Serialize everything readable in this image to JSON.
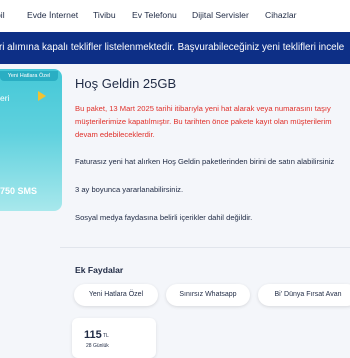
{
  "nav": {
    "items": [
      "bil",
      "Evde İnternet",
      "Tivibu",
      "Ev Telefonu",
      "Dijital Servisler",
      "Cihazlar"
    ]
  },
  "banner": {
    "text": "ri alımına kapalı teklifler listelenmektedir. Başvurabileceğiniz yeni teklifleri incele"
  },
  "card": {
    "tag": "Yeni Hatlara Özel",
    "label": "eri",
    "sms": "750 SMS"
  },
  "package": {
    "title": "Hoş Geldin 25GB",
    "notice_lines": [
      "Bu paket, 13 Mart 2025 tarihi itibarıyla yeni hat alarak veya numarasını taşıy",
      "müşterilerimize kapatılmıştır. Bu tarihten önce pakete kayıt olan müşterilerim",
      "devam edebileceklerdir."
    ],
    "paragraphs": [
      "Faturasız yeni hat alırken Hoş Geldin paketlerinden birini de satın alabilirsiniz",
      "3 ay boyunca yararlanabilirsiniz.",
      "Sosyal medya faydasına belirli içerikler dahil değildir."
    ]
  },
  "extras": {
    "title": "Ek Faydalar",
    "chips": [
      "Yeni Hatlara Özel",
      "Sınırsız Whatsapp",
      "Bi' Dünya Fırsat Avan"
    ]
  },
  "price": {
    "amount": "115",
    "unit": "TL",
    "period": "28 Günlük"
  }
}
